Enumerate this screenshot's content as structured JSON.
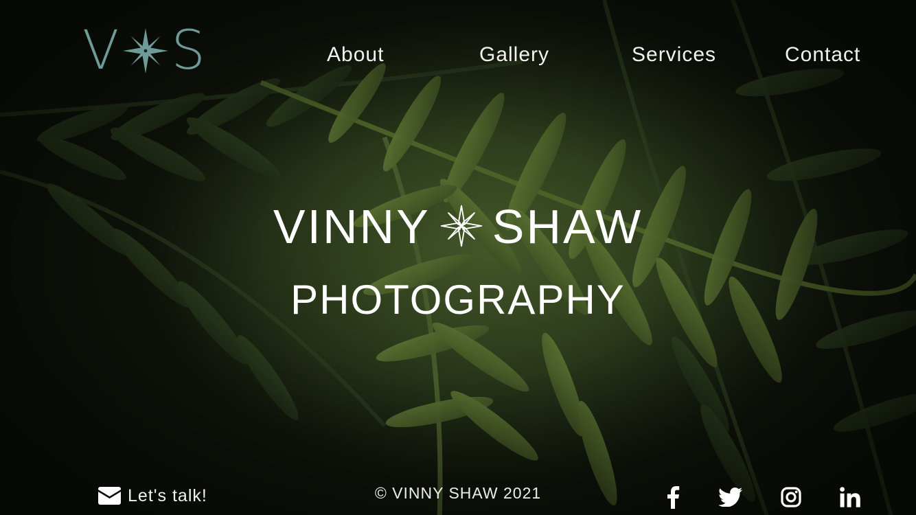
{
  "site": {
    "logo": {
      "left_letter": "V",
      "right_letter": "S",
      "color": "#6f9a9a"
    },
    "nav": {
      "items": [
        {
          "label": "About"
        },
        {
          "label": "Gallery"
        },
        {
          "label": "Services"
        },
        {
          "label": "Contact"
        }
      ]
    }
  },
  "hero": {
    "title_left": "VINNY",
    "title_right": "SHAW",
    "subtitle": "PHOTOGRAPHY"
  },
  "footer": {
    "contact_label": "Let's talk!",
    "copyright": "© VINNY SHAW 2021",
    "social": [
      {
        "icon": "facebook-icon"
      },
      {
        "icon": "twitter-icon"
      },
      {
        "icon": "instagram-icon"
      },
      {
        "icon": "linkedin-icon"
      }
    ]
  },
  "colors": {
    "logo_accent": "#6f9a9a",
    "text": "#ffffff",
    "background": "#141a10"
  }
}
